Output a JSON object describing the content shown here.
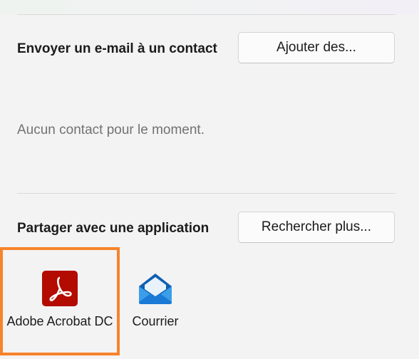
{
  "email_section": {
    "title": "Envoyer un e-mail à un contact",
    "add_button": "Ajouter des...",
    "empty_message": "Aucun contact pour le moment."
  },
  "app_section": {
    "title": "Partager avec une application",
    "search_button": "Rechercher plus...",
    "apps": [
      {
        "label": "Adobe Acrobat DC",
        "icon": "adobe-acrobat-icon",
        "selected": true
      },
      {
        "label": "Courrier",
        "icon": "mail-icon",
        "selected": false
      }
    ]
  },
  "colors": {
    "selection_border": "#f7832a",
    "acrobat_red": "#b30b00",
    "mail_blue": "#0a64c8"
  }
}
